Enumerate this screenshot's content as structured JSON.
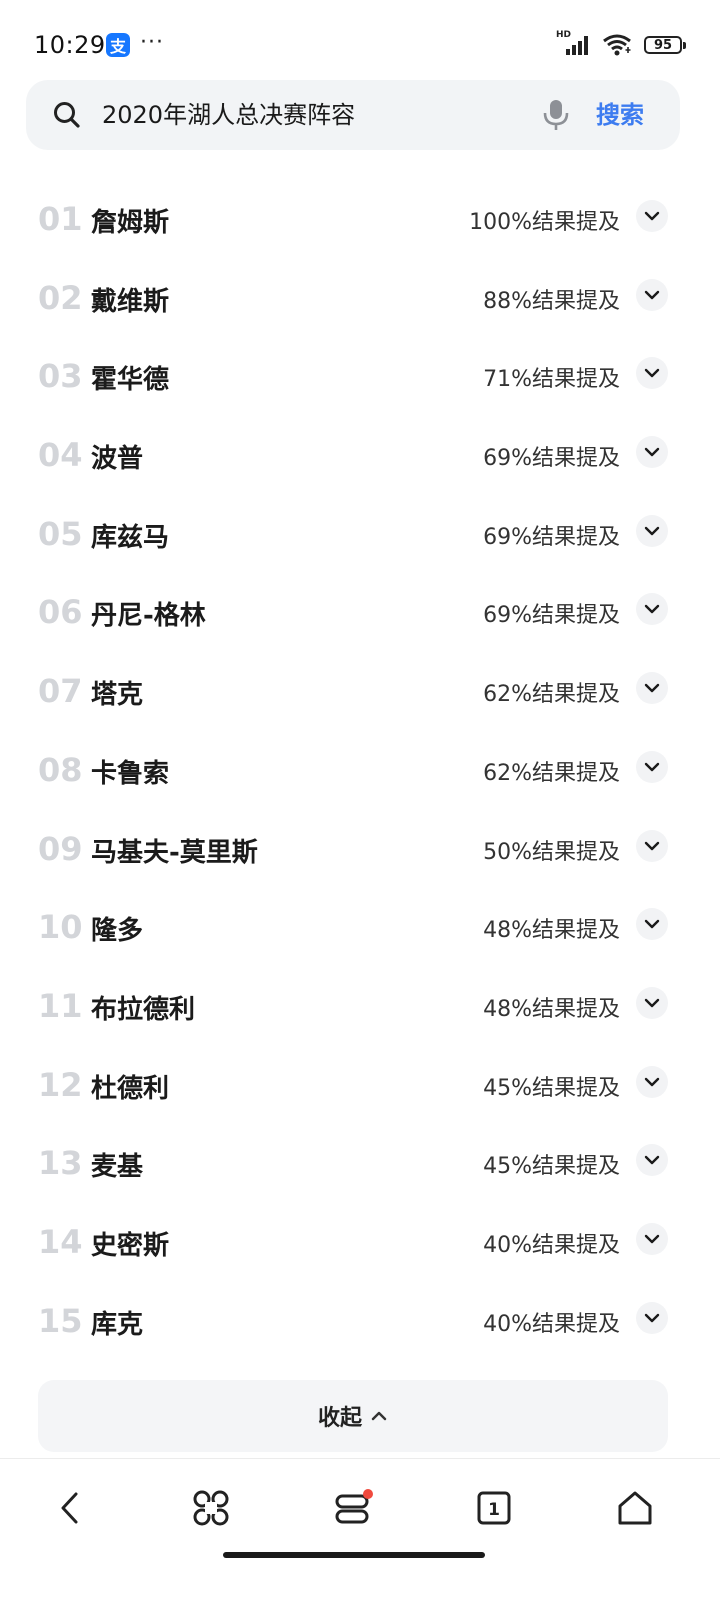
{
  "status_bar": {
    "time": "10:29",
    "alipay_glyph": "支",
    "more": "···",
    "network": "HD",
    "battery": "95"
  },
  "search": {
    "query": "2020年湖人总决赛阵容",
    "button_label": "搜索"
  },
  "results": [
    {
      "rank": "01",
      "name": "詹姆斯",
      "mention": "100%结果提及"
    },
    {
      "rank": "02",
      "name": "戴维斯",
      "mention": "88%结果提及"
    },
    {
      "rank": "03",
      "name": "霍华德",
      "mention": "71%结果提及"
    },
    {
      "rank": "04",
      "name": "波普",
      "mention": "69%结果提及"
    },
    {
      "rank": "05",
      "name": "库兹马",
      "mention": "69%结果提及"
    },
    {
      "rank": "06",
      "name": "丹尼-格林",
      "mention": "69%结果提及"
    },
    {
      "rank": "07",
      "name": "塔克",
      "mention": "62%结果提及"
    },
    {
      "rank": "08",
      "name": "卡鲁索",
      "mention": "62%结果提及"
    },
    {
      "rank": "09",
      "name": "马基夫-莫里斯",
      "mention": "50%结果提及"
    },
    {
      "rank": "10",
      "name": "隆多",
      "mention": "48%结果提及"
    },
    {
      "rank": "11",
      "name": "布拉德利",
      "mention": "48%结果提及"
    },
    {
      "rank": "12",
      "name": "杜德利",
      "mention": "45%结果提及"
    },
    {
      "rank": "13",
      "name": "麦基",
      "mention": "45%结果提及"
    },
    {
      "rank": "14",
      "name": "史密斯",
      "mention": "40%结果提及"
    },
    {
      "rank": "15",
      "name": "库克",
      "mention": "40%结果提及"
    }
  ],
  "collapse": {
    "label": "收起"
  },
  "bottom_nav": {
    "tabs_count": "1"
  },
  "colors": {
    "accent": "#3d7cf0",
    "rank_gray": "#d3d5d9",
    "badge_red": "#f04a3e"
  }
}
